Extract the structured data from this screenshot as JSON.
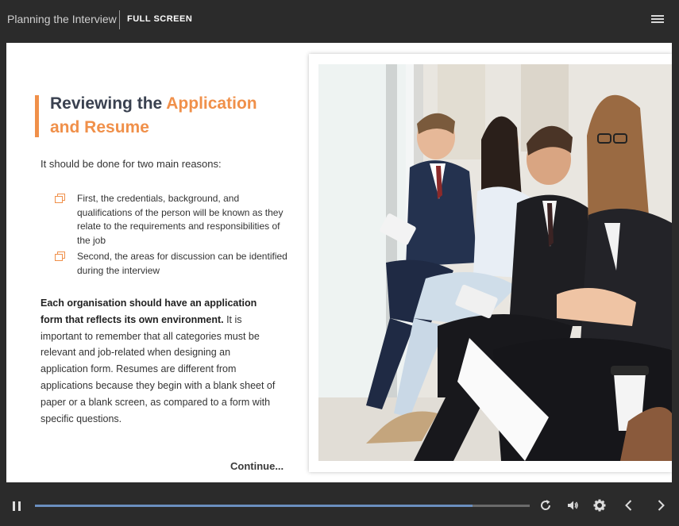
{
  "header": {
    "title": "Planning the Interview",
    "fullscreen_label": "FULL SCREEN"
  },
  "slide": {
    "heading_part1": "Reviewing the ",
    "heading_highlight": "Application and Resume",
    "intro": "It should be done for two main reasons:",
    "bullets": [
      "First, the credentials, background, and qualifications of the person will be known as they relate to the requirements and responsibilities of the job",
      "Second, the areas for discussion can be identified during the interview"
    ],
    "para_bold": "Each organisation should have an application form that reflects its own environment.",
    "para_rest": " It is important to remember that all categories must be relevant and job-related when designing an application form. Resumes are different from applications because they begin with a blank sheet of paper or a blank screen, as compared to a form with specific questions.",
    "continue_label": "Continue..."
  },
  "player": {
    "progress_fraction": 0.885
  },
  "colors": {
    "accent": "#f0904a",
    "heading": "#3a4150",
    "progress": "#6b8fbf",
    "chrome": "#2b2b2b"
  },
  "icons": [
    "menu-icon",
    "copy-icon",
    "pause-icon",
    "replay-icon",
    "volume-icon",
    "settings-icon",
    "prev-icon",
    "next-icon"
  ]
}
